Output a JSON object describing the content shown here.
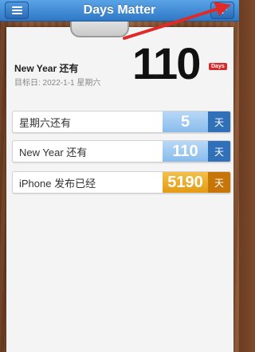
{
  "navbar": {
    "title": "Days Matter",
    "left_icon": "menu-icon",
    "right_icon": "plus-icon",
    "color": "#3a85d3"
  },
  "annotation": {
    "arrow_color": "#e02a2a"
  },
  "hero": {
    "name": "New Year 还有",
    "target": "目标日: 2022-1-1 星期六",
    "number": "110",
    "unit": "Days",
    "unit_color": "#d62a2a"
  },
  "events": [
    {
      "label": "星期六还有",
      "count": "5",
      "unit": "天",
      "kind": "future"
    },
    {
      "label": "New Year 还有",
      "count": "110",
      "unit": "天",
      "kind": "future"
    },
    {
      "label": "iPhone 发布已经",
      "count": "5190",
      "unit": "天",
      "kind": "past"
    }
  ],
  "colors": {
    "future": "#2f70b9",
    "past": "#e39b14"
  }
}
